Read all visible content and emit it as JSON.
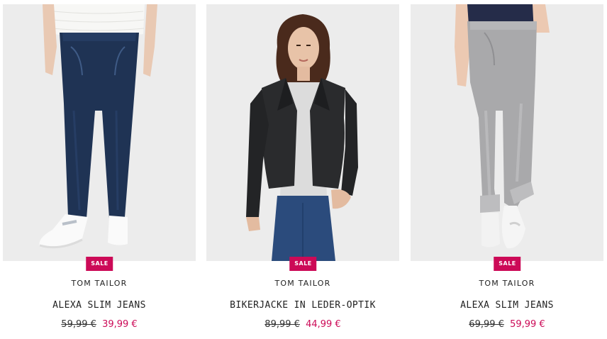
{
  "products": [
    {
      "badge": "SALE",
      "brand": "TOM TAILOR",
      "name": "ALEXA SLIM JEANS",
      "old_price": "59,99 €",
      "new_price": "39,99 €",
      "image": "dark-blue-jeans-photo"
    },
    {
      "badge": "SALE",
      "brand": "TOM TAILOR",
      "name": "BIKERJACKE IN LEDER-OPTIK",
      "old_price": "89,99 €",
      "new_price": "44,99 €",
      "image": "black-leather-jacket-photo"
    },
    {
      "badge": "SALE",
      "brand": "TOM TAILOR",
      "name": "ALEXA SLIM JEANS",
      "old_price": "69,99 €",
      "new_price": "59,99 €",
      "image": "grey-jeans-photo"
    }
  ],
  "colors": {
    "sale_badge": "#cc0a57",
    "sale_price": "#cc0a57",
    "image_background": "#ececec"
  }
}
